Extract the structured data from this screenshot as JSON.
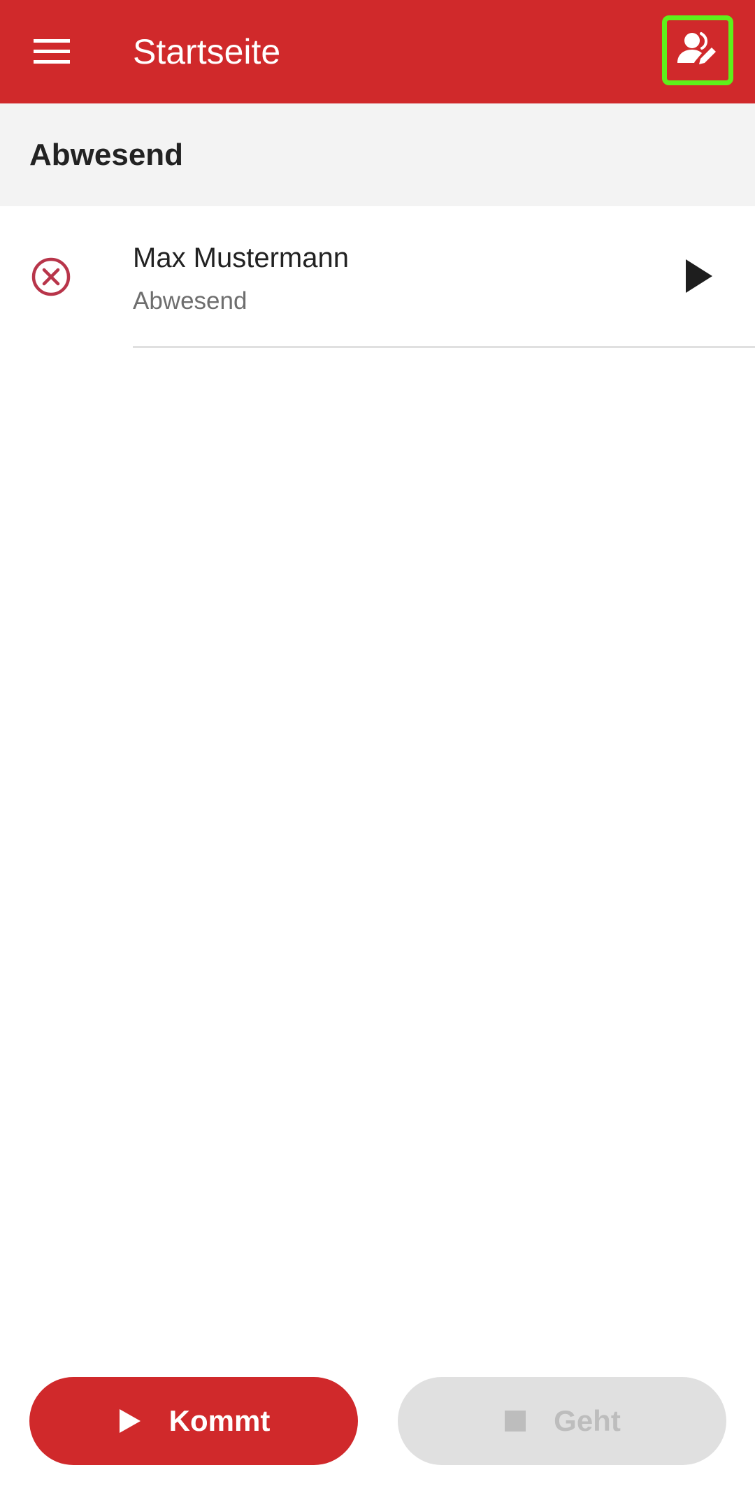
{
  "appbar": {
    "title": "Startseite",
    "menu_icon": "hamburger-menu-icon",
    "action_icon": "user-edit-icon",
    "color": "#d0292b",
    "highlight_color": "#5ef01a"
  },
  "section": {
    "title": "Abwesend"
  },
  "list": {
    "items": [
      {
        "name": "Max Mustermann",
        "status": "Abwesend",
        "status_icon": "absent-x-circle-icon",
        "status_color": "#b8354a",
        "action_icon": "play-arrow-icon"
      }
    ]
  },
  "actions": {
    "kommt_label": "Kommt",
    "kommt_icon": "play-icon",
    "geht_label": "Geht",
    "geht_icon": "stop-icon",
    "geht_enabled": false
  }
}
